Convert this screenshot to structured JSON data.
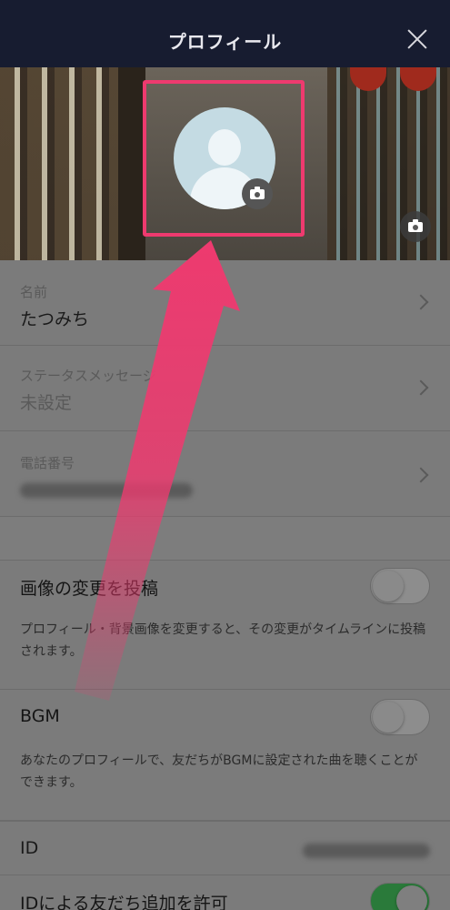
{
  "header": {
    "title": "プロフィール",
    "close_icon": "close-icon"
  },
  "cover": {
    "cover_camera_icon": "camera-icon",
    "avatar_camera_icon": "camera-icon",
    "highlight_color": "#ee3a6f"
  },
  "profile": {
    "name_label": "名前",
    "name_value": "たつみち",
    "status_label": "ステータスメッセージ",
    "status_value": "未設定",
    "phone_label": "電話番号"
  },
  "settings": {
    "post_image_change_label": "画像の変更を投稿",
    "post_image_change_on": false,
    "post_image_change_desc": "プロフィール・背景画像を変更すると、その変更がタイムラインに投稿されます。",
    "bgm_label": "BGM",
    "bgm_on": false,
    "bgm_desc": "あなたのプロフィールで、友だちがBGMに設定された曲を聴くことができます。",
    "id_label": "ID",
    "allow_add_by_id_label": "IDによる友だち追加を許可",
    "allow_add_by_id_on": true
  }
}
